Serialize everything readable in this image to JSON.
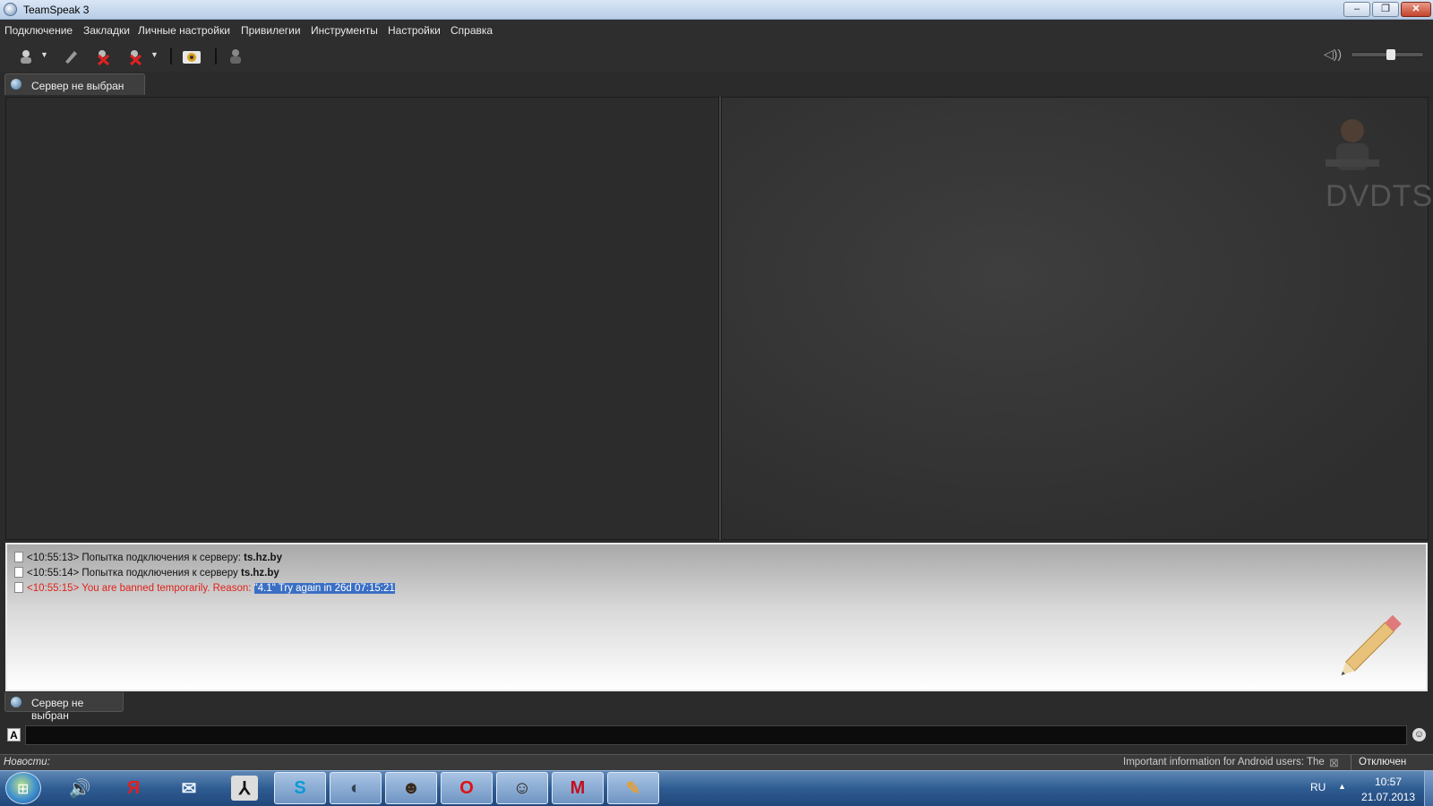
{
  "window": {
    "title": "TeamSpeak 3",
    "app_icon": "teamspeak-icon"
  },
  "window_controls": {
    "minimize": "–",
    "maximize": "❐",
    "close": "✕"
  },
  "menu": [
    "Подключение",
    "Закладки",
    "Личные настройки",
    "Привилегии",
    "Инструменты",
    "Настройки",
    "Справка"
  ],
  "toolbar": {
    "icons": [
      "connect-icon",
      "bookmark-icon",
      "disconnect-icon",
      "disconnect-all-icon",
      "camera-icon",
      "away-icon"
    ],
    "volume_icon": "speaker-icon",
    "volume_level": 0.55
  },
  "server_tab": {
    "label": "Сервер не выбран"
  },
  "info_panel": {
    "watermark": "DVDTS"
  },
  "log": [
    {
      "time": "<10:55:13>",
      "text": "Попытка подключения к серверу:",
      "server": "ts.hz.by",
      "error": false
    },
    {
      "time": "<10:55:14>",
      "text": "Попытка подключения к серверу",
      "server": "ts.hz.by",
      "error": false
    },
    {
      "time": "<10:55:15>",
      "text": "You are banned temporarily. Reason:",
      "highlight": "\"4.1\" Try again in 26d 07:15:21",
      "error": true
    }
  ],
  "bottom_tab": {
    "label": "Сервер не выбран"
  },
  "chat": {
    "font_button": "A",
    "input_value": "",
    "emoji_icon": "smiley-icon"
  },
  "news": {
    "label": "Новости:",
    "text": "Important information for Android users: The",
    "status": "Отключен"
  },
  "taskbar": {
    "start_icon": "windows-start-icon",
    "apps": [
      "speaker-app-icon",
      "yandex-icon",
      "mail-icon",
      "counter-strike-icon",
      "skype-icon",
      "teamspeak-taskbar-icon",
      "agent-icon",
      "opera-icon",
      "gta-icon",
      "mcafee-icon",
      "paint-icon"
    ],
    "lang": "RU",
    "tray_arrow": "▲",
    "time": "10:57",
    "date": "21.07.2013"
  },
  "colors": {
    "error": "#e0201a",
    "selection": "#3b6fc4",
    "taskbar": "#2e5c92"
  }
}
